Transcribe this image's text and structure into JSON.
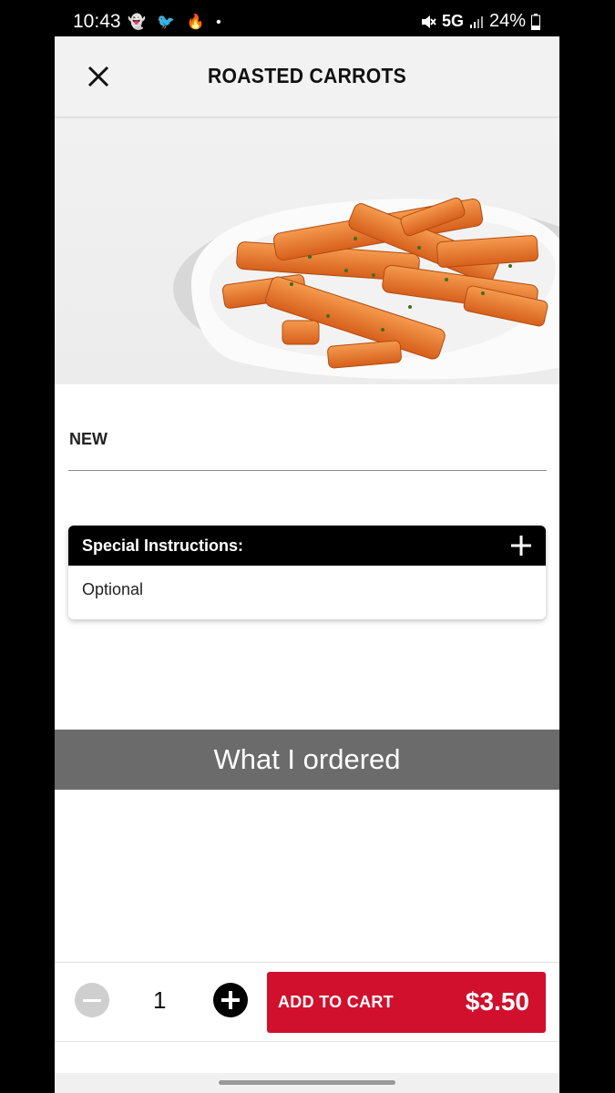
{
  "status_bar": {
    "time": "10:43",
    "left_icons": "👻 🐦 🔥 •",
    "network": "5G",
    "battery": "24%"
  },
  "header": {
    "title": "ROASTED CARROTS",
    "close_icon": "close-icon"
  },
  "product": {
    "tag": "NEW",
    "image": "roasted-carrots-plate"
  },
  "special_instructions": {
    "title": "Special Instructions:",
    "placeholder": "Optional",
    "expand_icon": "plus-icon"
  },
  "overlay_caption": "What I ordered",
  "cart": {
    "quantity": "1",
    "add_label": "ADD TO CART",
    "price": "$3.50",
    "accent_color": "#d0102d"
  }
}
